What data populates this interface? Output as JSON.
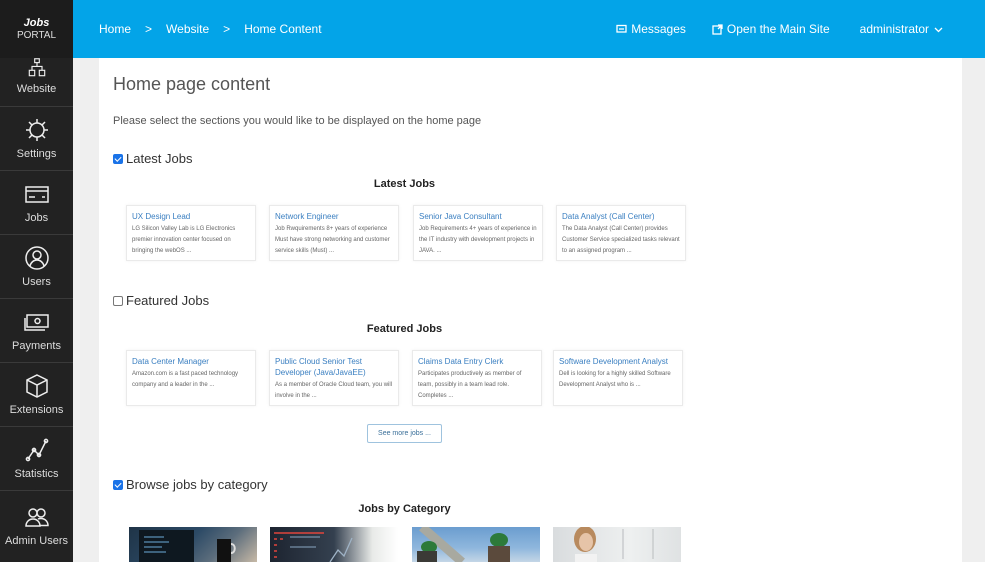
{
  "app": {
    "logo_line1": "Jobs",
    "logo_line2": "PORTAL"
  },
  "sidebar": {
    "items": [
      {
        "label": "Website",
        "icon": "sitemap-icon"
      },
      {
        "label": "Settings",
        "icon": "gear-icon"
      },
      {
        "label": "Jobs",
        "icon": "card-icon"
      },
      {
        "label": "Users",
        "icon": "user-icon"
      },
      {
        "label": "Payments",
        "icon": "money-icon"
      },
      {
        "label": "Extensions",
        "icon": "cube-icon"
      },
      {
        "label": "Statistics",
        "icon": "line-chart-icon"
      },
      {
        "label": "Admin Users",
        "icon": "users-icon"
      }
    ]
  },
  "header": {
    "breadcrumb": [
      "Home",
      "Website",
      "Home Content"
    ],
    "separator": ">",
    "messages": "Messages",
    "open_site": "Open the Main Site",
    "user": "administrator"
  },
  "main": {
    "title": "Home page content",
    "intro": "Please select the sections you would like to be displayed on the home page",
    "sections": [
      {
        "toggle_label": "Latest Jobs",
        "checked": true,
        "heading": "Latest Jobs",
        "jobs": [
          {
            "title": "UX Design Lead",
            "desc": "LG Silicon Valley Lab is LG Electronics premier innovation center focused on bringing the webOS ..."
          },
          {
            "title": "Network Engineer",
            "desc": "Job Rwquirements 8+ years of experience Must have strong networking and customer service skills (Must) ..."
          },
          {
            "title": "Senior Java Consultant",
            "desc": "Job Requirements 4+ years of experience in the IT industry with development projects in JAVA. ..."
          },
          {
            "title": "Data Analyst (Call Center)",
            "desc": "The Data Analyst (Call Center) provides Customer Service specialized tasks relevant to an assigned program ..."
          }
        ]
      },
      {
        "toggle_label": "Featured Jobs",
        "checked": false,
        "heading": "Featured Jobs",
        "jobs": [
          {
            "title": "Data Center Manager",
            "desc": "Amazon.com is a fast paced technology company and a leader in the ..."
          },
          {
            "title": "Public Cloud Senior Test Developer (Java/JavaEE)",
            "desc": "As a member of Oracle Cloud team, you will involve in the ..."
          },
          {
            "title": "Claims Data Entry Clerk",
            "desc": "Participates productively as member of team, possibly in a team lead role. Completes ..."
          },
          {
            "title": "Software Development Analyst",
            "desc": "Dell is looking for a highly skilled Software Development Analyst who is ..."
          }
        ],
        "see_more": "See more jobs ..."
      },
      {
        "toggle_label": "Browse jobs by category",
        "checked": true,
        "heading": "Jobs by Category",
        "images": [
          "laptop-and-mug-photo",
          "trading-screens-photo",
          "construction-workers-photo",
          "presenter-woman-photo"
        ]
      }
    ]
  }
}
